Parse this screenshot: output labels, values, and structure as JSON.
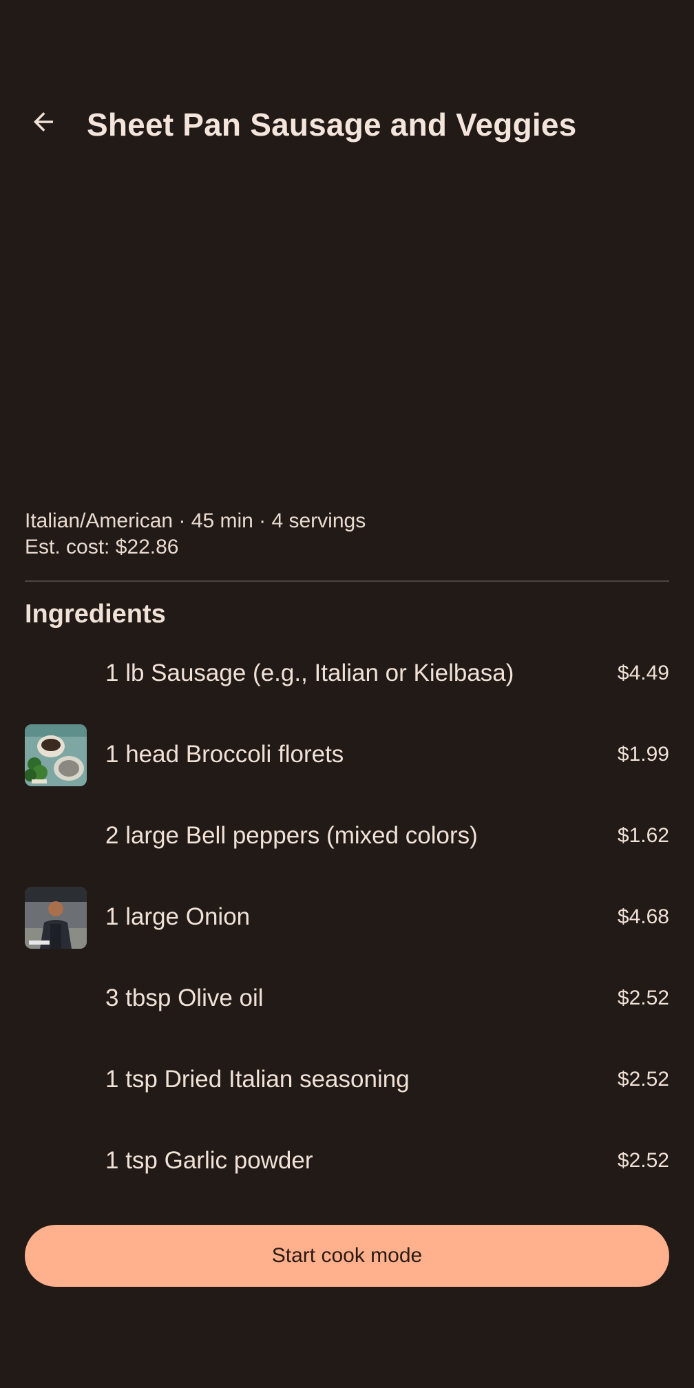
{
  "header": {
    "back_icon": "arrow-left-icon",
    "title": "Sheet Pan Sausage and Veggies"
  },
  "meta": {
    "details": "Italian/American · 45 min · 4 servings",
    "cost": "Est. cost: $22.86"
  },
  "ingredients_section": {
    "title": "Ingredients",
    "items": [
      {
        "name": "1 lb Sausage (e.g., Italian or Kielbasa)",
        "price": "$4.49",
        "has_thumb": false
      },
      {
        "name": "1 head Broccoli florets",
        "price": "$1.99",
        "has_thumb": true,
        "thumb": "broccoli-photo"
      },
      {
        "name": "2 large Bell peppers (mixed colors)",
        "price": "$1.62",
        "has_thumb": false
      },
      {
        "name": "1 large Onion",
        "price": "$4.68",
        "has_thumb": true,
        "thumb": "chef-photo"
      },
      {
        "name": "3 tbsp Olive oil",
        "price": "$2.52",
        "has_thumb": false
      },
      {
        "name": "1 tsp Dried Italian seasoning",
        "price": "$2.52",
        "has_thumb": false
      },
      {
        "name": "1 tsp Garlic powder",
        "price": "$2.52",
        "has_thumb": false
      }
    ]
  },
  "actions": {
    "cook_mode_label": "Start cook mode"
  },
  "colors": {
    "background": "#221a16",
    "text": "#f1e2d8",
    "accent": "#ffb08d",
    "divider": "#4e4541"
  }
}
